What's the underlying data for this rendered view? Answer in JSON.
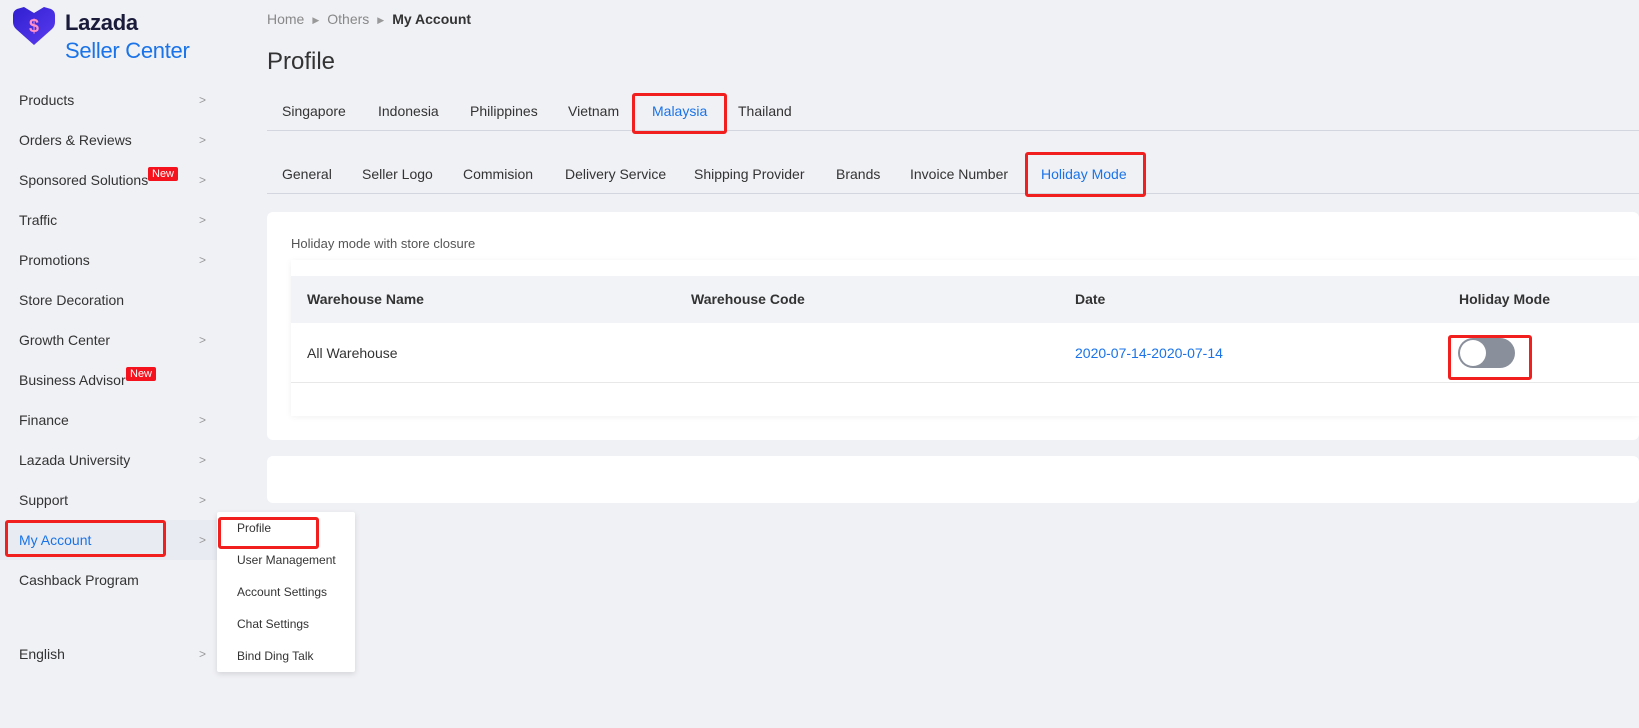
{
  "brand": {
    "name": "Lazada",
    "subtitle": "Seller Center",
    "logo_icon": "lazada-heart-icon",
    "logo_color": "#3b2bd6"
  },
  "sidebar": {
    "items": [
      {
        "label": "Products",
        "chevron": true
      },
      {
        "label": "Orders & Reviews",
        "chevron": true
      },
      {
        "label": "Sponsored Solutions",
        "chevron": true,
        "badge": "New"
      },
      {
        "label": "Traffic",
        "chevron": true
      },
      {
        "label": "Promotions",
        "chevron": true
      },
      {
        "label": "Store Decoration",
        "chevron": false
      },
      {
        "label": "Growth Center",
        "chevron": true
      },
      {
        "label": "Business Advisor",
        "chevron": false,
        "badge": "New"
      },
      {
        "label": "Finance",
        "chevron": true
      },
      {
        "label": "Lazada University",
        "chevron": true
      },
      {
        "label": "Support",
        "chevron": true
      },
      {
        "label": "My Account",
        "chevron": true,
        "active": true
      },
      {
        "label": "Cashback Program",
        "chevron": false
      }
    ],
    "language": "English"
  },
  "submenu": {
    "items": [
      "Profile",
      "User Management",
      "Account Settings",
      "Chat Settings",
      "Bind Ding Talk"
    ]
  },
  "breadcrumb": {
    "items": [
      "Home",
      "Others"
    ],
    "current": "My Account"
  },
  "page_title": "Profile",
  "country_tabs": {
    "items": [
      "Singapore",
      "Indonesia",
      "Philippines",
      "Vietnam",
      "Malaysia",
      "Thailand"
    ],
    "active": "Malaysia"
  },
  "section_tabs": {
    "items": [
      "General",
      "Seller Logo",
      "Commision",
      "Delivery Service",
      "Shipping Provider",
      "Brands",
      "Invoice Number",
      "Holiday Mode"
    ],
    "active": "Holiday Mode"
  },
  "holiday": {
    "description": "Holiday mode with store closure",
    "columns": [
      "Warehouse Name",
      "Warehouse Code",
      "Date",
      "Holiday Mode"
    ],
    "rows": [
      {
        "name": "All Warehouse",
        "code": "",
        "date": "2020-07-14-2020-07-14",
        "holiday_mode": false
      }
    ]
  },
  "colors": {
    "accent": "#1a73e8",
    "highlight": "#f21f1f",
    "badge": "#f5121d",
    "toggle_off": "#8a8f9c"
  }
}
